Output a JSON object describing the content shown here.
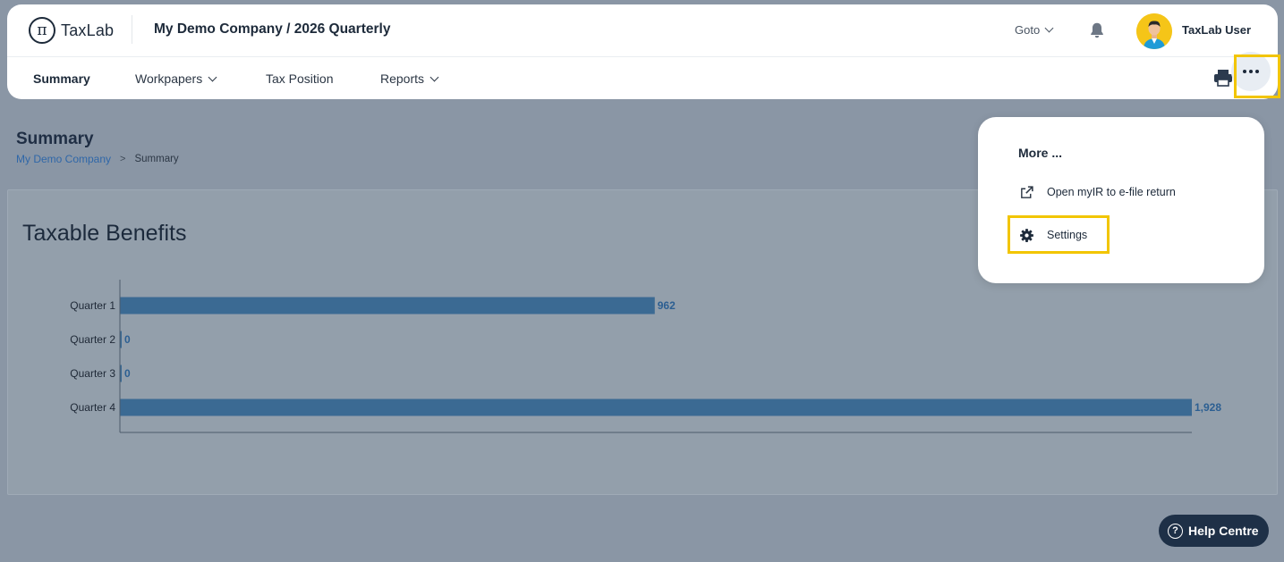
{
  "brand": {
    "name": "TaxLab",
    "glyph": "π"
  },
  "header": {
    "title": "My Demo Company / 2026 Quarterly",
    "goto_label": "Goto",
    "username": "TaxLab User"
  },
  "tabs": [
    {
      "label": "Summary",
      "active": true
    },
    {
      "label": "Workpapers",
      "dropdown": true
    },
    {
      "label": "Tax Position"
    },
    {
      "label": "Reports",
      "dropdown": true
    }
  ],
  "page": {
    "title": "Summary",
    "breadcrumb": {
      "link": "My Demo Company",
      "separator": ">",
      "current": "Summary"
    }
  },
  "menu": {
    "title": "More ...",
    "items": [
      {
        "label": "Open myIR to e-file return",
        "icon": "external-link-icon"
      },
      {
        "label": "Settings",
        "icon": "gear-icon"
      }
    ]
  },
  "help": {
    "label": "Help Centre",
    "icon_glyph": "?"
  },
  "colors": {
    "bar": "#3b6a93",
    "bar_label": "#2c5f92",
    "highlight": "#f2c500",
    "background": "#8a96a5",
    "help_bg": "#1e3047"
  },
  "chart_data": {
    "type": "bar",
    "orientation": "horizontal",
    "title": "Taxable Benefits",
    "categories": [
      "Quarter 1",
      "Quarter 2",
      "Quarter 3",
      "Quarter 4"
    ],
    "values": [
      962,
      0,
      0,
      1928
    ],
    "value_labels": [
      "962",
      "0",
      "0",
      "1,928"
    ],
    "xlim": [
      0,
      1928
    ],
    "grid": false,
    "legend": "none"
  }
}
